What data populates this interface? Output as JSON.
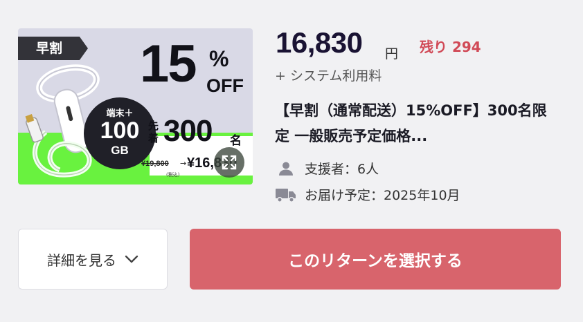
{
  "image": {
    "ribbon": "早割",
    "discount_number": "15",
    "discount_percent": "%",
    "discount_off": "OFF",
    "badge_top": "端末＋",
    "badge_num": "100",
    "badge_unit": "GB",
    "first_come": "先着",
    "limit_count": "300",
    "limit_unit": "名",
    "old_price": "¥19,800",
    "new_price": "¥16,830",
    "tax_note": "(税込)",
    "colors": {
      "green": "#69f23f",
      "lavender": "#d9d9e6"
    }
  },
  "price": {
    "amount": "16,830",
    "currency": "円",
    "remaining": "残り 294",
    "fee_note": "+ システム利用料"
  },
  "title": "【早割（通常配送）15%OFF】300名限定 一般販売予定価格...",
  "meta": {
    "supporters": "支援者：6人",
    "delivery": "お届け予定：2025年10月"
  },
  "buttons": {
    "details": "詳細を見る",
    "select": "このリターンを選択する"
  },
  "colors": {
    "accent": "#d8646c",
    "remaining": "#d14a57"
  }
}
